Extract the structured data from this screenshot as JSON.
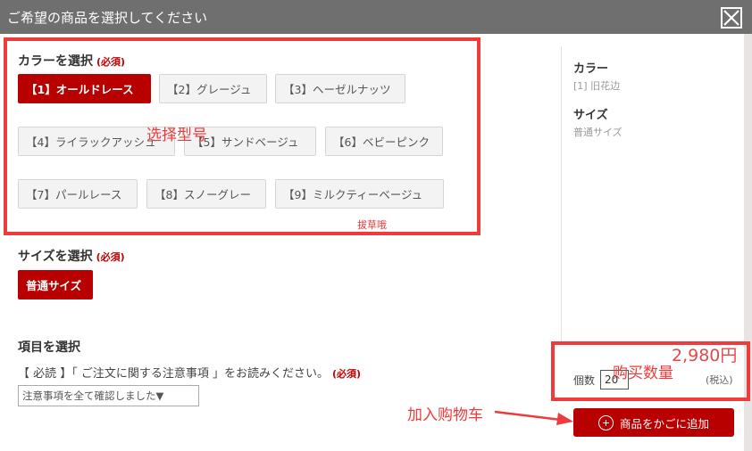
{
  "header": {
    "title": "ご希望の商品を選択してください"
  },
  "color_section": {
    "title": "カラーを選択",
    "required": "(必須)",
    "options": [
      "【1】オールドレース",
      "【2】グレージュ",
      "【3】ヘーゼルナッツ",
      "【4】ライラックアッシュ",
      "【5】サンドベージュ",
      "【6】ベビーピンク",
      "【7】パールレース",
      "【8】スノーグレー",
      "【9】ミルクティーベージュ"
    ]
  },
  "size_section": {
    "title": "サイズを選択",
    "required": "(必須)",
    "options": [
      "普通サイズ"
    ]
  },
  "item_section": {
    "title": "項目を選択",
    "notice": "【 必読 】「 ご注文に関する注意事項 」をお読みください。",
    "required": "(必須)",
    "select_value": "注意事項を全て確認しました▼"
  },
  "summary": {
    "color_label": "カラー",
    "color_value": "[1] 旧花边",
    "size_label": "サイズ",
    "size_value": "普通サイズ"
  },
  "purchase": {
    "price": "2,980円",
    "qty_label": "個数",
    "qty_value": "20",
    "tax": "(税込)",
    "add_button": "商品をかごに追加",
    "add_icon": "+"
  },
  "annotations": {
    "select_model": "选择型号",
    "small_note": "拔草哦",
    "quantity": "购买数量",
    "add_to_cart": "加入购物车"
  },
  "colors": {
    "accent": "#b80000",
    "annotation": "#ee3b3b",
    "header": "#6f6f6f"
  }
}
